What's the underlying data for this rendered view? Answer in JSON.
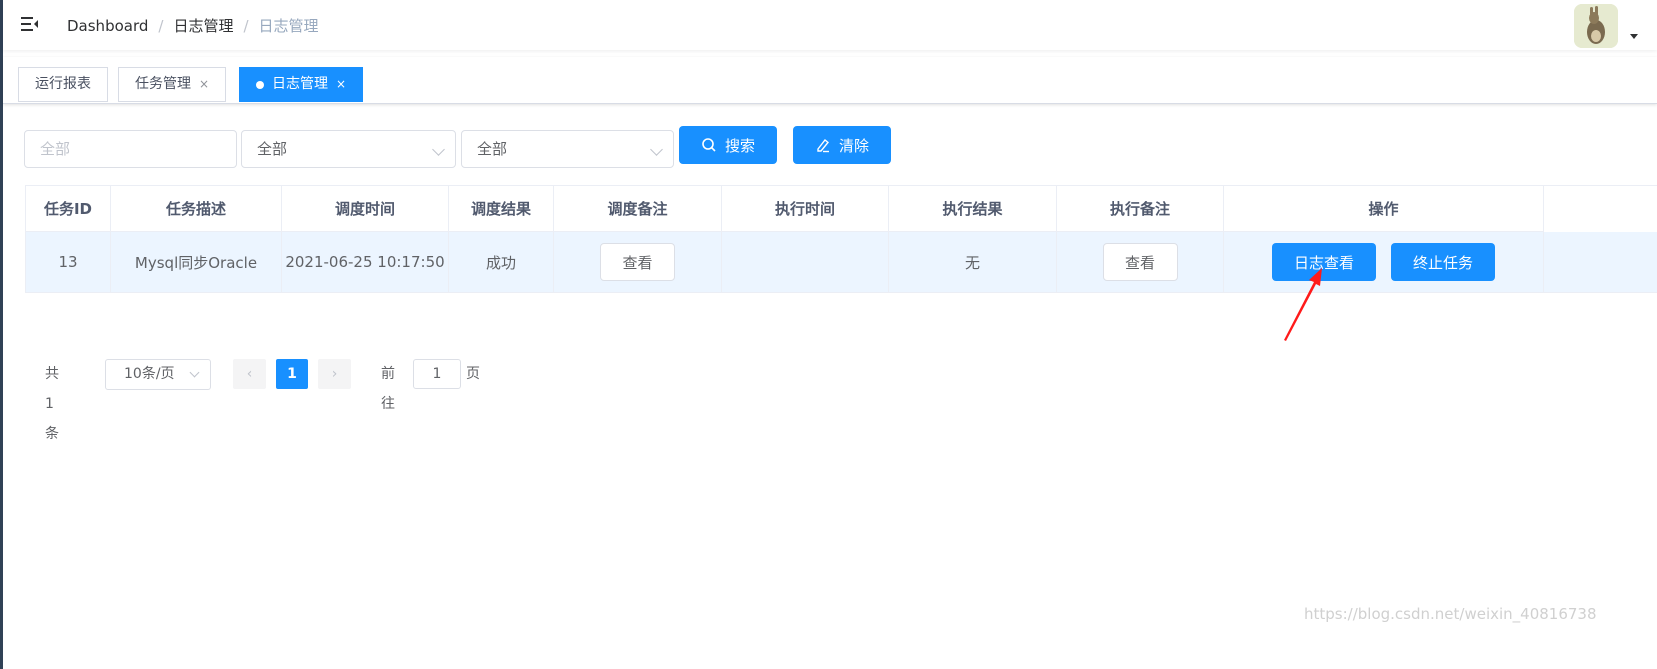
{
  "navbar": {
    "breadcrumb": [
      "Dashboard",
      "日志管理",
      "日志管理"
    ],
    "separator": "/",
    "avatar_icon": "avatar-rabbit"
  },
  "tags": [
    {
      "label": "运行报表",
      "closable": false,
      "active": false
    },
    {
      "label": "任务管理",
      "closable": true,
      "active": false
    },
    {
      "label": "日志管理",
      "closable": true,
      "active": true
    }
  ],
  "tag_close_glyph": "×",
  "filters": {
    "task_input_placeholder": "全部",
    "select1_value": "全部",
    "select2_value": "全部",
    "search_label": "搜索",
    "clear_label": "清除"
  },
  "table": {
    "columns": [
      "任务ID",
      "任务描述",
      "调度时间",
      "调度结果",
      "调度备注",
      "执行时间",
      "执行结果",
      "执行备注",
      "操作"
    ],
    "rows": [
      {
        "id": "13",
        "desc": "Mysql同步Oracle",
        "trigger_time": "2021-06-25 10:17:50",
        "trigger_result": "成功",
        "trigger_note_btn": "查看",
        "exec_time": "",
        "exec_result": "无",
        "exec_note_btn": "查看",
        "log_btn": "日志查看",
        "stop_btn": "终止任务"
      }
    ]
  },
  "pagination": {
    "total": "共 1 条",
    "page_size": "10条/页",
    "current_page": "1",
    "goto_label": "前往",
    "goto_value": "1",
    "goto_suffix": "页"
  },
  "colors": {
    "primary": "#1890ff",
    "row_highlight": "#ecf5ff",
    "annotation_arrow": "#ff1a1a"
  },
  "watermark": "https://blog.csdn.net/weixin_40816738"
}
